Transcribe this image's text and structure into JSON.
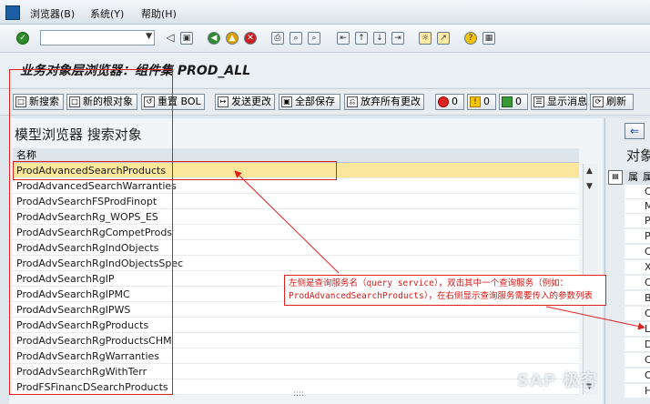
{
  "menu": {
    "items": [
      "浏览器(B)",
      "系统(Y)",
      "帮助(H)"
    ]
  },
  "toolbar": {
    "command_value": "",
    "icons": [
      "check-icon",
      "back-icon",
      "save-icon",
      "green-back-icon",
      "exit-icon",
      "cancel-icon",
      "print-icon",
      "find-icon",
      "find-next-icon",
      "first-page-icon",
      "prev-page-icon",
      "next-page-icon",
      "last-page-icon",
      "new-session-icon",
      "shortcut-icon",
      "help-icon",
      "layout-icon"
    ]
  },
  "header": {
    "title": "业务对象层浏览器：组件集 PROD_ALL"
  },
  "app_toolbar": {
    "buttons": [
      "新搜索",
      "新的根对象",
      "重置 BOL",
      "发送更改",
      "全部保存",
      "放弃所有更改",
      "0",
      "0",
      "0",
      "显示消息",
      "刷新"
    ]
  },
  "left_panel": {
    "title": "模型浏览器 搜索对象",
    "column_header": "名称",
    "rows": [
      "ProdAdvancedSearchProducts",
      "ProdAdvancedSearchWarranties",
      "ProdAdvSearchFSProdFinopt",
      "ProdAdvSearchRg_WOPS_ES",
      "ProdAdvSearchRgCompetProds",
      "ProdAdvSearchRgIndObjects",
      "ProdAdvSearchRgIndObjectsSpec",
      "ProdAdvSearchRgIP",
      "ProdAdvSearchRgIPMC",
      "ProdAdvSearchRgIPWS",
      "ProdAdvSearchRgProducts",
      "ProdAdvSearchRgProductsCHM",
      "ProdAdvSearchRgWarranties",
      "ProdAdvSearchRgWithTerr",
      "ProdFSFinancDSearchProducts"
    ],
    "selected_index": 0
  },
  "right_panel": {
    "title": "对象",
    "head_a": "属",
    "head_b": "属",
    "row_letters": [
      "C",
      "M",
      "P",
      "P",
      "C",
      "X",
      "C",
      "B",
      "C",
      "L",
      "D",
      "C",
      "O",
      "H"
    ]
  },
  "annotation": {
    "line1": "左侧是查询服务名（query service），双击其中一个查询服务（例如：",
    "line2": "ProdAdvancedSearchProducts），在右侧显示查询服务需要传入的参数列表"
  },
  "watermark": "SAP 极客"
}
